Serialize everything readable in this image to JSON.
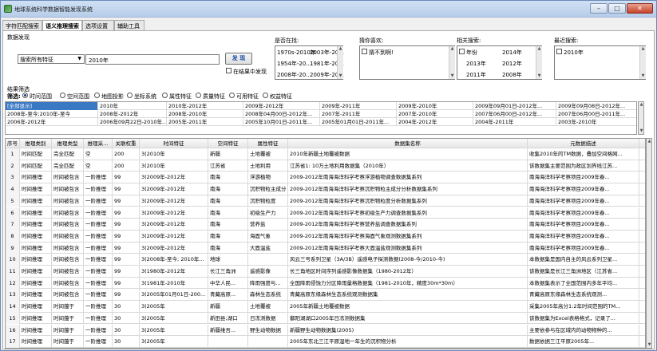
{
  "window": {
    "title": "地球系统科学数据智能发现系统",
    "controls": [
      "–",
      "□",
      "✕"
    ]
  },
  "tabs": [
    "字符匹配搜索",
    "语义推理搜索",
    "选项设置",
    "辅助工具"
  ],
  "discovery": {
    "section_label": "数据发现",
    "search_type": "搜索所有特征",
    "search_text": "2010年",
    "discover_button": "发 现",
    "in_results_checkbox": "在结果中发现"
  },
  "is_it_found": {
    "label": "是否在找:",
    "items": [
      [
        "1970s-2010年",
        "2003年-20..."
      ],
      [
        "1954年-20...",
        "1981年-20..."
      ],
      [
        "2008年-20...",
        "2009年-20..."
      ]
    ]
  },
  "you_like": {
    "label": "猜你喜欢:",
    "items": [
      "猜不到啊!"
    ]
  },
  "related": {
    "label": "相关搜索:",
    "items": [
      [
        "年份",
        "2014年"
      ],
      [
        "2013年",
        "2012年"
      ],
      [
        "2011年",
        "2008年"
      ]
    ]
  },
  "recent": {
    "label": "最近搜索:",
    "items": [
      "2010年"
    ]
  },
  "filter": {
    "section_label": "结果筛选",
    "label": "筛选:",
    "options": [
      "时间范围",
      "空间范围",
      "地图投影",
      "坐标系统",
      "属性特征",
      "质量特征",
      "可用特征",
      "权益特征"
    ],
    "selected_index": 0
  },
  "range_rows": [
    [
      "[全部显示]",
      "2010年",
      "2010年-2012年",
      "2009年-2012年",
      "2009年-2011年",
      "2009年-2010年",
      "2009年09月01日-2012年...",
      "2009年09月08日-2012年..."
    ],
    [
      "2008年-至今;2010年-至今",
      "2008年-2012年",
      "2008年-2010年",
      "2008年04月00日-2012年...",
      "2007年-2011年",
      "2007年-2010年",
      "2007年06月00日-2012年...",
      "2007年06月00日-2011年..."
    ],
    [
      "2006年-2012年",
      "2006年09月22日-2010年...",
      "2005年-2011年",
      "2005年10月01日-2011年...",
      "2005年01月01日-2011年...",
      "2004年-2012年",
      "2004年-2011年",
      "2003年-2010年"
    ]
  ],
  "table": {
    "headers": [
      "序号",
      "推理类别",
      "推理类型",
      "推理采...",
      "关联权重",
      "时间特征",
      "空间特征",
      "属性特征",
      "数据集名称",
      "元数据描述"
    ],
    "rows": [
      [
        "1",
        "时间匹配",
        "完全匹配",
        "空",
        "200",
        "3(2010年",
        "新疆",
        "土地覆被",
        "2010年新疆土地覆被数据",
        "收集2010年的TM数据，叠加空间格网..."
      ],
      [
        "2",
        "时间匹配",
        "完全匹配",
        "空",
        "200",
        "3(2010年",
        "江苏省",
        "土地利用",
        "江苏省1: 10万土地利用数据集（2010年）",
        "该数据集主要范围为政区划界线江苏..."
      ],
      [
        "3",
        "时间推理",
        "时间被包含",
        "一阶推理",
        "99",
        "3(2009年-2012年",
        "南海",
        "浮游植物",
        "2009-2012年南海海洋科学考察浮游植物调查数据集系列",
        "南海海洋科学考察项目2009年春..."
      ],
      [
        "4",
        "时间推理",
        "时间被包含",
        "一阶推理",
        "99",
        "3(2009年-2012年",
        "南海",
        "沉积物粒主成分",
        "2009-2012年南海海洋科学考察沉积物粒主成分分析数据集系列",
        "南海海洋科学考察项目2009年春..."
      ],
      [
        "5",
        "时间推理",
        "时间被包含",
        "一阶推理",
        "99",
        "3(2009年-2012年",
        "南海",
        "沉积物粒度",
        "2009-2012年南海海洋科学考察沉积物粒度分析数据集系列",
        "南海海洋科学考察项目2009年春..."
      ],
      [
        "6",
        "时间推理",
        "时间被包含",
        "一阶推理",
        "99",
        "3(2009年-2012年",
        "南海",
        "初级生产力",
        "2009-2012年南海海洋科学考察初级生产力调查数据集系列",
        "南海海洋科学考察项目2009年春..."
      ],
      [
        "7",
        "时间推理",
        "时间被包含",
        "一阶推理",
        "99",
        "3(2009年-2012年",
        "南海",
        "营养盐",
        "2009-2012年南海海洋科学考察营养盐调查数据集系列",
        "南海海洋科学考察项目2009年春..."
      ],
      [
        "8",
        "时间推理",
        "时间被包含",
        "一阶推理",
        "99",
        "3(2009年-2012年",
        "南海",
        "海面气象",
        "2009-2012年南海海洋科学考察海面气象观测数据集系列",
        "南海海洋科学考察项目2009年春..."
      ],
      [
        "9",
        "时间推理",
        "时间被包含",
        "一阶推理",
        "99",
        "3(2009年-2012年",
        "南海",
        "大面温盐",
        "2009-2012年南海海洋科学考察大面温盐观测数据集系列",
        "南海海洋科学考察项目2009年春..."
      ],
      [
        "10",
        "时间推理",
        "时间被包含",
        "一阶推理",
        "99",
        "3(2008年-至今; 2010年...",
        "地球",
        "",
        "风云三号系列卫星（3A/3B）遥感电子探测数据(2008-今/2010-今)",
        "本数据集是国内自主的风云系列卫星..."
      ],
      [
        "11",
        "时间推理",
        "时间被包含",
        "一阶推理",
        "99",
        "3(1980年-2012年",
        "长江三角洲",
        "遥感影像",
        "长三角地区时间序列遥感影像数据集（1980-2012年）",
        "该数据集是长江三角洲地区（江苏省..."
      ],
      [
        "12",
        "时间推理",
        "时间被包含",
        "一阶推理",
        "99",
        "3(1981年-2010年",
        "中华人民...",
        "降雨强度与...",
        "全国降雨侵蚀力分区降雨量格数据集（1981-2010年，精度30m*30m）",
        "本数据集表示了全国范围内多年平均..."
      ],
      [
        "13",
        "时间推理",
        "时间被包含",
        "一阶推理",
        "99",
        "3(2005年01月01日-200...",
        "青藏高原...",
        "森林生态系统",
        "青藏高原东缘森林生态系统观测数据集",
        "青藏高原东缘森林生态系统观测..."
      ],
      [
        "14",
        "时间推理",
        "时间蕴于",
        "一阶推理",
        "30",
        "3(2005年",
        "新疆",
        "土地覆被",
        "2005年新疆土地覆被数据",
        "采集2005年高分1:2年时间范围的TM..."
      ],
      [
        "15",
        "时间推理",
        "时间蕴于",
        "一阶推理",
        "30",
        "3(2005年",
        "新田县;湖口",
        "日冻测数据",
        "鄱阳湖湖口2005年日冻测数据集",
        "该数据集为Excel表格格式，记录了..."
      ],
      [
        "16",
        "时间推理",
        "时间蕴于",
        "一阶推理",
        "30",
        "3(2005年",
        "新疆维吾...",
        "野生动物数据",
        "新疆野生动物数据集(2005)",
        "主要依参与在区域内的动物物种的..."
      ],
      [
        "17",
        "时间推理",
        "时间蕴于",
        "一阶推理",
        "30",
        "3(2005年",
        "",
        "",
        "2005年东北三江平原湿地一年生的沉积物分析",
        "数据依据三江平原2005年..."
      ]
    ]
  }
}
